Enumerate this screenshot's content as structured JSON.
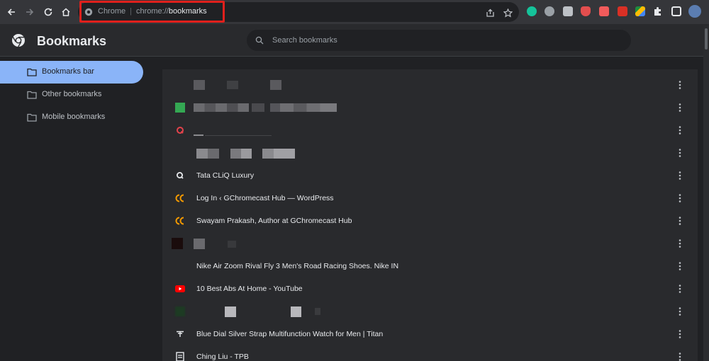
{
  "browser": {
    "omnibox": {
      "scheme": "Chrome",
      "separator": "|",
      "url_prefix": "chrome://",
      "url_path": "bookmarks"
    }
  },
  "header": {
    "title": "Bookmarks",
    "search": {
      "placeholder": "Search bookmarks",
      "value": ""
    }
  },
  "sidebar": {
    "items": [
      {
        "label": "Bookmarks bar",
        "selected": true
      },
      {
        "label": "Other bookmarks",
        "selected": false
      },
      {
        "label": "Mobile bookmarks",
        "selected": false
      }
    ]
  },
  "bookmarks": [
    {
      "title": "",
      "favicon": "blurred-favicon"
    },
    {
      "title": "",
      "favicon": "green-square-favicon"
    },
    {
      "title": "",
      "favicon": "red-q-favicon"
    },
    {
      "title": "",
      "favicon": "blank-favicon"
    },
    {
      "title": "Tata CLiQ Luxury",
      "favicon": "q-favicon"
    },
    {
      "title": "Log In ‹ GChromecast Hub — WordPress",
      "favicon": "gchromecast-favicon"
    },
    {
      "title": "Swayam Prakash, Author at GChromecast Hub",
      "favicon": "gchromecast-favicon"
    },
    {
      "title": "",
      "favicon": "dark-square-favicon"
    },
    {
      "title": "Nike Air Zoom Rival Fly 3 Men's Road Racing Shoes. Nike IN",
      "favicon": "blank-favicon"
    },
    {
      "title": "10 Best Abs At Home - YouTube",
      "favicon": "youtube-favicon"
    },
    {
      "title": "",
      "favicon": "blurred-green-favicon"
    },
    {
      "title": "Blue Dial Silver Strap Multifunction Watch for Men | Titan",
      "favicon": "titan-favicon"
    },
    {
      "title": "Ching Liu - TPB",
      "favicon": "tpb-favicon"
    }
  ],
  "colors": {
    "accent": "#8ab4f8",
    "highlight_annotation": "#e0201c",
    "gchromecast": "#f29900",
    "youtube": "#ff0000"
  }
}
